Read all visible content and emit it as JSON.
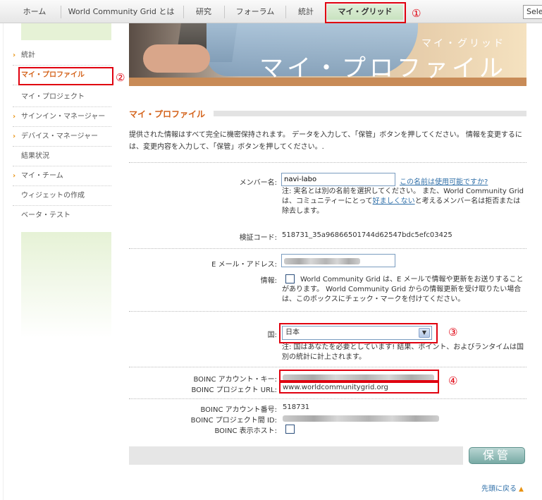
{
  "nav": {
    "tabs": [
      "ホーム",
      "World Community Grid とは",
      "研究",
      "フォーラム",
      "統計",
      "マイ・グリッド"
    ],
    "select_label": "Sele"
  },
  "annotations": [
    "①",
    "②",
    "③",
    "④"
  ],
  "sidebar": {
    "items": [
      "統計",
      "マイ・プロファイル",
      "マイ・プロジェクト",
      "サインイン・マネージャー",
      "デバイス・マネージャー",
      "結果状況",
      "マイ・チーム",
      "ウィジェットの作成",
      "ベータ・テスト"
    ]
  },
  "banner": {
    "subtitle": "マイ・グリッド",
    "title": "マイ・プロファイル"
  },
  "page": {
    "section_title": "マイ・プロファイル",
    "intro": "提供された情報はすべて完全に機密保持されます。 データを入力して、「保管」ボタンを押してください。 情報を変更するには、変更内容を入力して、「保管」ボタンを押してください。."
  },
  "form": {
    "member_name_label": "メンバー名:",
    "member_name_value": "navi-labo",
    "availability_link": "この名前は使用可能ですか?",
    "member_note_before": "注: 実名とは別の名前を選択してください。 また、World Community Grid は、コミュニティーにとって",
    "member_note_link": "好ましくない",
    "member_note_after": "と考えるメンバー名は拒否または除去します。",
    "verify_label": "検証コード:",
    "verify_value": "518731_35a96866501744d62547bdc5efc03425",
    "email_label": "E メール・アドレス:",
    "info_label": "情報:",
    "info_text": "World Community Grid は、E メールで情報や更新をお送りすることがあります。 World Community Grid からの情報更新を受け取りたい場合は、このボックスにチェック・マークを付けてください。",
    "country_label": "国:",
    "country_value": "日本",
    "country_note": "注: 国はあなたを必要としています! 結果、ポイント、およびランタイムは国別の統計に計上されます。",
    "boinc_key_label": "BOINC アカウント・キー:",
    "boinc_url_label": "BOINC プロジェクト URL:",
    "boinc_url_value": "www.worldcommunitygrid.org",
    "boinc_account_label": "BOINC アカウント番号:",
    "boinc_account_value": "518731",
    "boinc_cross_label": "BOINC プロジェクト間 ID:",
    "boinc_host_label": "BOINC 表示ホスト:",
    "save_label": "保管",
    "back_to_top": "先頭に戻る"
  }
}
